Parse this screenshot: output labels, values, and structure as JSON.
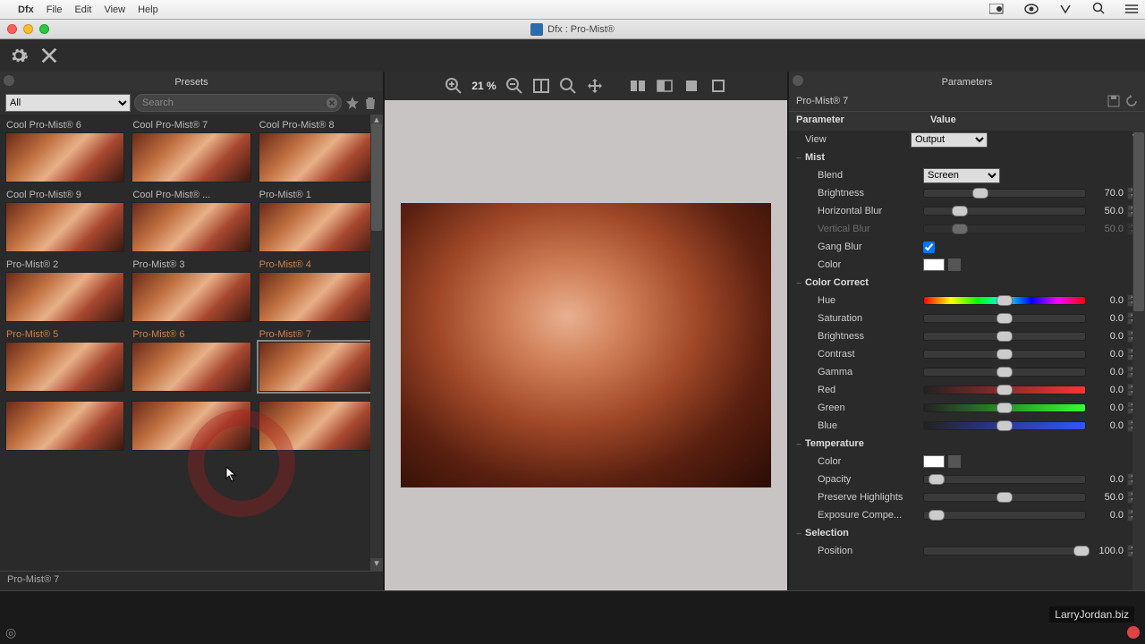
{
  "mac_menu": {
    "app": "Dfx",
    "items": [
      "File",
      "Edit",
      "View",
      "Help"
    ]
  },
  "window": {
    "title": "Dfx : Pro-Mist®"
  },
  "presets_panel": {
    "title": "Presets",
    "filter_dropdown": "All",
    "search_placeholder": "Search",
    "footer": "Pro-Mist® 7",
    "presets": [
      "Cool Pro-Mist® 6",
      "Cool Pro-Mist® 7",
      "Cool Pro-Mist® 8",
      "Cool Pro-Mist® 9",
      "Cool Pro-Mist® ...",
      "Pro-Mist® 1",
      "Pro-Mist® 2",
      "Pro-Mist® 3",
      "Pro-Mist® 4",
      "Pro-Mist® 5",
      "Pro-Mist® 6",
      "Pro-Mist® 7",
      "",
      "",
      ""
    ],
    "selected_index": 11
  },
  "viewer": {
    "zoom": "21 %"
  },
  "parameters_panel": {
    "title": "Parameters",
    "preset_title": "Pro-Mist® 7",
    "col_parameter": "Parameter",
    "col_value": "Value",
    "rows": [
      {
        "type": "dropdown",
        "indent": 1,
        "name": "View",
        "value": "Output"
      },
      {
        "type": "group",
        "name": "Mist"
      },
      {
        "type": "dropdown",
        "indent": 2,
        "name": "Blend",
        "value": "Screen"
      },
      {
        "type": "slider",
        "indent": 2,
        "name": "Brightness",
        "value": 70.0,
        "pos": 35
      },
      {
        "type": "slider",
        "indent": 2,
        "name": "Horizontal Blur",
        "value": 50.0,
        "pos": 22
      },
      {
        "type": "slider",
        "indent": 2,
        "name": "Vertical Blur",
        "value": 50.0,
        "pos": 22,
        "dim": true
      },
      {
        "type": "check",
        "indent": 2,
        "name": "Gang Blur",
        "checked": true
      },
      {
        "type": "color",
        "indent": 2,
        "name": "Color",
        "swatch": "#ffffff"
      },
      {
        "type": "group",
        "name": "Color Correct"
      },
      {
        "type": "slider",
        "indent": 2,
        "name": "Hue",
        "value": 0.0,
        "pos": 50,
        "track": "hue"
      },
      {
        "type": "slider",
        "indent": 2,
        "name": "Saturation",
        "value": 0.0,
        "pos": 50
      },
      {
        "type": "slider",
        "indent": 2,
        "name": "Brightness",
        "value": 0.0,
        "pos": 50
      },
      {
        "type": "slider",
        "indent": 2,
        "name": "Contrast",
        "value": 0.0,
        "pos": 50
      },
      {
        "type": "slider",
        "indent": 2,
        "name": "Gamma",
        "value": 0.0,
        "pos": 50
      },
      {
        "type": "slider",
        "indent": 2,
        "name": "Red",
        "value": 0.0,
        "pos": 50,
        "track": "red"
      },
      {
        "type": "slider",
        "indent": 2,
        "name": "Green",
        "value": 0.0,
        "pos": 50,
        "track": "green"
      },
      {
        "type": "slider",
        "indent": 2,
        "name": "Blue",
        "value": 0.0,
        "pos": 50,
        "track": "blue"
      },
      {
        "type": "group",
        "name": "Temperature"
      },
      {
        "type": "color",
        "indent": 2,
        "name": "Color",
        "swatch": "#ffffff"
      },
      {
        "type": "slider",
        "indent": 2,
        "name": "Opacity",
        "value": 0.0,
        "pos": 8
      },
      {
        "type": "slider",
        "indent": 2,
        "name": "Preserve Highlights",
        "value": 50.0,
        "pos": 50
      },
      {
        "type": "slider",
        "indent": 2,
        "name": "Exposure Compe...",
        "value": 0.0,
        "pos": 8
      },
      {
        "type": "group",
        "name": "Selection"
      },
      {
        "type": "slider",
        "indent": 2,
        "name": "Position",
        "value": 100.0,
        "pos": 98
      }
    ]
  },
  "watermark": "LarryJordan.biz"
}
